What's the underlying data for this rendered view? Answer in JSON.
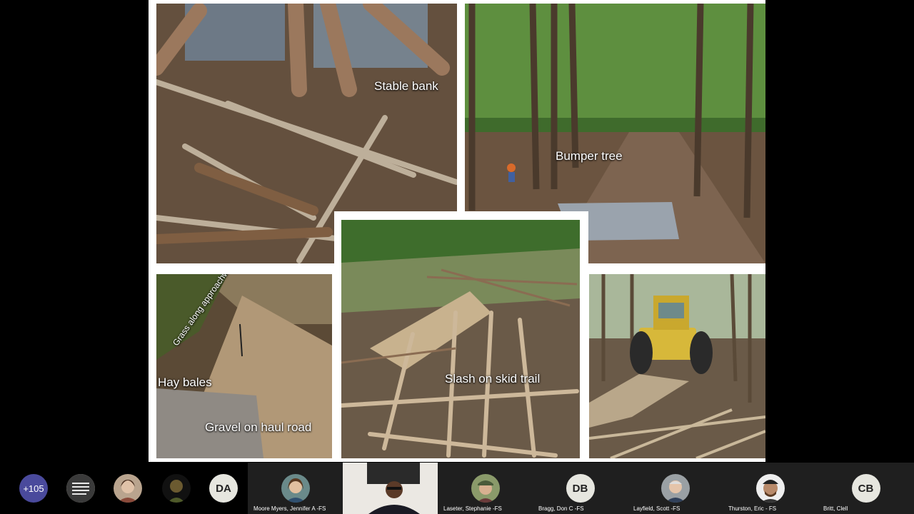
{
  "slide": {
    "photos": [
      {
        "id": "stable-bank",
        "label": "Stable bank"
      },
      {
        "id": "bumper-tree",
        "label": "Bumper tree"
      },
      {
        "id": "hay-bales",
        "label": "Hay bales",
        "label2": "Gravel on haul road",
        "label3": "Grass along approachway"
      },
      {
        "id": "slash",
        "label": "Slash on skid trail"
      },
      {
        "id": "skidder",
        "label": ""
      }
    ]
  },
  "participants": {
    "overflow_count": "+105",
    "tiles": [
      {
        "initials": "DA",
        "name": ""
      },
      {
        "initials": "",
        "name": "Moore Myers, Jennifer A -FS"
      },
      {
        "initials": "",
        "name": ""
      },
      {
        "initials": "",
        "name": "Laseter, Stephanie -FS"
      },
      {
        "initials": "DB",
        "name": "Bragg, Don C -FS"
      },
      {
        "initials": "",
        "name": "Layfield, Scott -FS"
      },
      {
        "initials": "",
        "name": "Thurston, Eric - FS"
      },
      {
        "initials": "CB",
        "name": "Britt, Clell"
      }
    ]
  },
  "colors": {
    "background": "#000000",
    "overflow_badge": "#4a4a9c",
    "initials_badge": "#e6e6df",
    "tile_dark": "#1f1f1f"
  }
}
